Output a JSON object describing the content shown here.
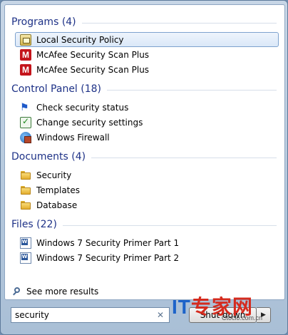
{
  "groups": [
    {
      "title": "Programs (4)",
      "items": [
        {
          "label": "Local Security Policy",
          "icon": "security-policy-icon",
          "selected": true
        },
        {
          "label": "McAfee Security Scan Plus",
          "icon": "mcafee-icon"
        },
        {
          "label": "McAfee Security Scan Plus",
          "icon": "mcafee-icon"
        }
      ]
    },
    {
      "title": "Control Panel (18)",
      "items": [
        {
          "label": "Check security status",
          "icon": "action-center-flag-icon"
        },
        {
          "label": "Change security settings",
          "icon": "security-settings-icon"
        },
        {
          "label": "Windows Firewall",
          "icon": "firewall-icon"
        }
      ]
    },
    {
      "title": "Documents (4)",
      "items": [
        {
          "label": "Security",
          "icon": "folder-icon"
        },
        {
          "label": "Templates",
          "icon": "folder-icon"
        },
        {
          "label": "Database",
          "icon": "folder-icon"
        }
      ]
    },
    {
      "title": "Files (22)",
      "items": [
        {
          "label": "Windows 7 Security Primer Part 1",
          "icon": "word-document-icon"
        },
        {
          "label": "Windows 7 Security Primer Part 2",
          "icon": "word-document-icon"
        }
      ]
    }
  ],
  "see_more": {
    "label": "See more results",
    "icon": "magnifier-icon"
  },
  "search": {
    "value": "security",
    "clear_icon": "clear-icon"
  },
  "shutdown": {
    "label": "Shut down",
    "arrow_icon": "arrow-right-icon"
  },
  "watermark": {
    "logo_it": "IT",
    "logo_cn": "专家网",
    "url": "Ctocio.com.cn"
  },
  "colors": {
    "group_title": "#1e3287",
    "selection_border": "#7da2ce",
    "frame": "#a9bfd6"
  }
}
